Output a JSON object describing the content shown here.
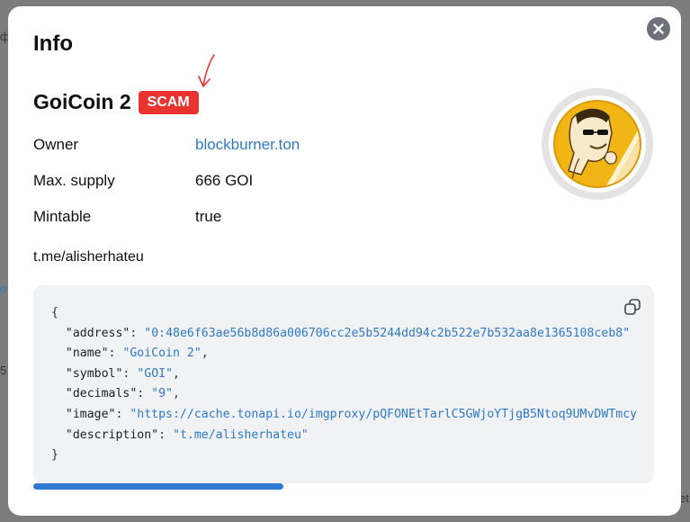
{
  "background": {
    "fragments": [
      "ф",
      "o",
      "5",
      "et"
    ]
  },
  "modal": {
    "title": "Info",
    "token": {
      "name": "GoiCoin 2",
      "badge": "SCAM"
    },
    "owner": {
      "label": "Owner",
      "value": "blockburner.ton"
    },
    "max_supply": {
      "label": "Max. supply",
      "value": "666 GOI"
    },
    "mintable": {
      "label": "Mintable",
      "value": "true"
    },
    "description": "t.me/alisherhateu",
    "json": {
      "open": "{",
      "close": "}",
      "fields": [
        {
          "key": "\"address\"",
          "value": "\"0:48e6f63ae56b8d86a006706cc2e5b5244dd94c2b522e7b532aa8e1365108ceb8\""
        },
        {
          "key": "\"name\"",
          "value": "\"GoiCoin 2\""
        },
        {
          "key": "\"symbol\"",
          "value": "\"GOI\""
        },
        {
          "key": "\"decimals\"",
          "value": "\"9\""
        },
        {
          "key": "\"image\"",
          "value": "\"https://cache.tonapi.io/imgproxy/pQFONEtTarlC5GWjoYTjgB5Ntoq9UMvDWTmcy"
        },
        {
          "key": "\"description\"",
          "value": "\"t.me/alisherhateu\""
        }
      ]
    }
  },
  "colors": {
    "scam_badge": "#e8332f",
    "link": "#2e7ac7",
    "scrollbar": "#2e7ad4"
  },
  "icons": [
    "close-icon",
    "copy-icon",
    "annotation-arrow",
    "token-avatar"
  ]
}
